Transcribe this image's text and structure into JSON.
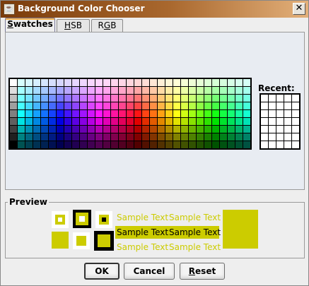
{
  "window": {
    "title": "Background Color Chooser",
    "close_glyph": "✕",
    "app_icon": "java-icon"
  },
  "tabs": [
    {
      "label": "Swatches",
      "mnemonic": "S",
      "active": true
    },
    {
      "label": "HSB",
      "mnemonic": "H",
      "active": false
    },
    {
      "label": "RGB",
      "mnemonic": "G",
      "active": false
    }
  ],
  "swatches": {
    "recent_label": "Recent:",
    "columns": 31,
    "rows": 9,
    "recent_columns": 5,
    "recent_rows": 7
  },
  "preview": {
    "label": "Preview",
    "sample_text": "Sample Text",
    "color": "#cccc00",
    "background": "#ffffff",
    "dark": "#000000"
  },
  "buttons": {
    "ok": "OK",
    "cancel": "Cancel",
    "reset": "Reset"
  }
}
